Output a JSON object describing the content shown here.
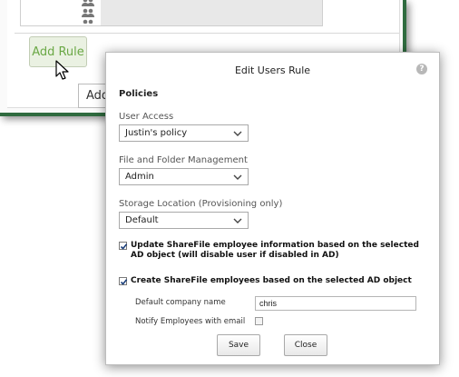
{
  "background": {
    "add_rule_label": "Add Rule",
    "tooltip_text": "Add a"
  },
  "dialog": {
    "title": "Edit Users Rule",
    "help_icon_glyph": "?",
    "policies_title": "Policies",
    "user_access": {
      "label": "User Access",
      "value": "Justin's policy"
    },
    "file_folder": {
      "label": "File and Folder Management",
      "value": "Admin"
    },
    "storage": {
      "label": "Storage Location (Provisioning only)",
      "value": "Default"
    },
    "update_employee": {
      "checked": true,
      "text": "Update ShareFile employee information based on the selected AD object (will disable user if disabled in AD)"
    },
    "create_employees": {
      "checked": true,
      "text": "Create ShareFile employees based on the selected AD object"
    },
    "company_name": {
      "label": "Default company name",
      "value": "chris"
    },
    "notify": {
      "label": "Notify Employees with email",
      "checked": false
    },
    "save_label": "Save",
    "close_label": "Close"
  },
  "colors": {
    "window_border": "#2f6b3f",
    "add_rule_text": "#6aa845",
    "add_rule_bg": "#eaf1e2"
  }
}
